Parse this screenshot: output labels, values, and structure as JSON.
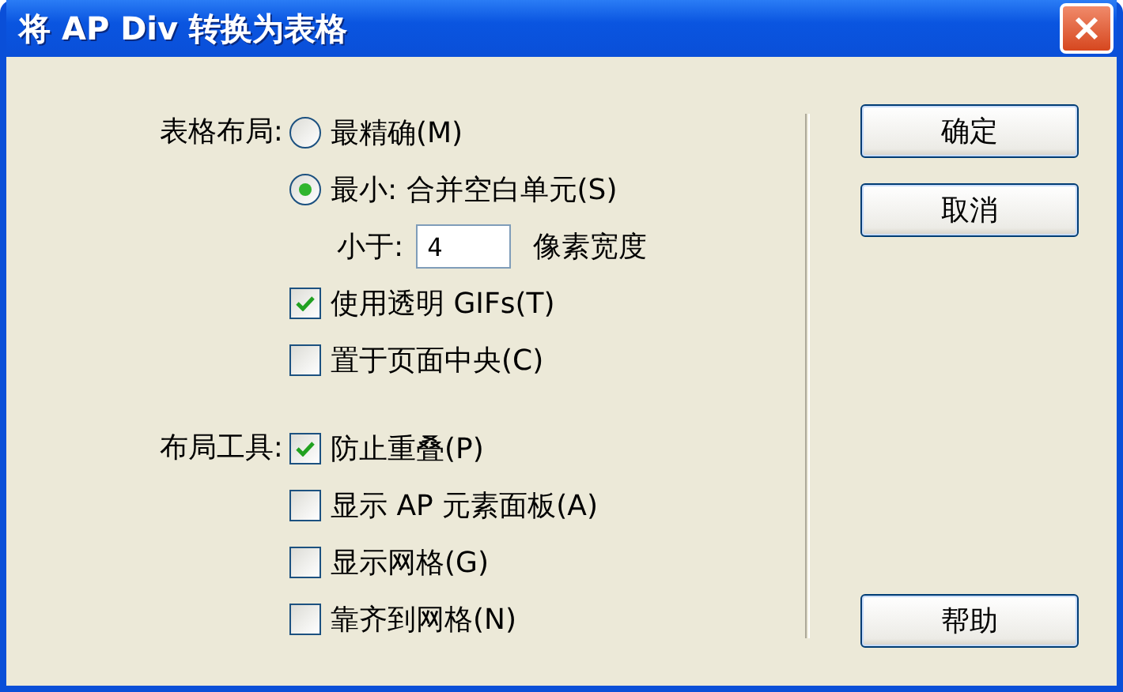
{
  "window": {
    "title": "将 AP Div 转换为表格"
  },
  "groups": [
    {
      "label": "表格布局:",
      "items": [
        {
          "kind": "radio",
          "label": "最精确(M)",
          "selected": false
        },
        {
          "kind": "radio",
          "label": "最小: 合并空白单元(S)",
          "selected": true
        },
        {
          "kind": "field",
          "label": "小于:",
          "value": "4",
          "suffix": "像素宽度"
        },
        {
          "kind": "checkbox",
          "label": "使用透明 GIFs(T)",
          "checked": true
        },
        {
          "kind": "checkbox",
          "label": "置于页面中央(C)",
          "checked": false
        }
      ]
    },
    {
      "label": "布局工具:",
      "items": [
        {
          "kind": "checkbox",
          "label": "防止重叠(P)",
          "checked": true
        },
        {
          "kind": "checkbox",
          "label": "显示 AP 元素面板(A)",
          "checked": false
        },
        {
          "kind": "checkbox",
          "label": "显示网格(G)",
          "checked": false
        },
        {
          "kind": "checkbox",
          "label": "靠齐到网格(N)",
          "checked": false
        }
      ]
    }
  ],
  "buttons": [
    "确定",
    "取消"
  ],
  "help_button": "帮助"
}
